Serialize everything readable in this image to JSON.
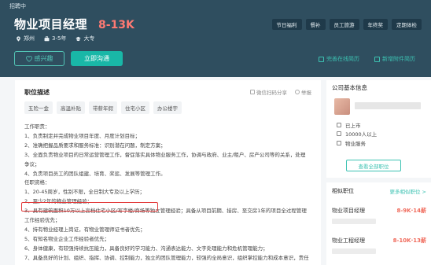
{
  "header": {
    "status": "招聘中",
    "job_title": "物业项目经理",
    "salary": "8-13K",
    "city": "郑州",
    "experience": "3-5年",
    "education": "大专",
    "tags": [
      "节日福利",
      "餐补",
      "员工旅游",
      "年终奖",
      "定期体检"
    ],
    "interest_label": "感兴趣",
    "chat_label": "立即沟通",
    "perfect_resume": "完善在线简历",
    "attach_resume": "新增附件简历"
  },
  "job": {
    "section_title": "职位描述",
    "wechat_share": "微信扫码分享",
    "report": "举报",
    "benefits": [
      "五险一金",
      "高温补贴",
      "带薪年假",
      "住宅小区",
      "办公楼宇"
    ],
    "desc_lines": [
      "工作职责：",
      "1、负责制定并完成物业项目年度、月度计划目标；",
      "2、准确把握品质要求和服务标准：识别潜在问题，制定方案；",
      "3、全面负责物业项目的日常运营管理工作，督促落实具体物业服务工作，协调与政府、业主/租户、房产公司等的关系，处理",
      "争议；",
      "4、负责项目员工的团队组建、培育、奖惩、发展等管理工作。",
      "任职资格：",
      "1、20-45周岁，性别不限，全日制大专及以上学历；",
      "2、至少2年的物业管理经验；",
      "3、具有建筑面积10万以上高档住宅小区/写字楼/商场等独立管理经验；具备从项目前期、接房、至交房1年的项目全过程管理",
      "工作经验优先；",
      "4、持有物业经理上岗证，有物业管理师证书者优先；",
      "5、有知名物业企业工作经验者优先；",
      "6、身体健康，有较强持续抗压能力，具备良好的学习能力、沟通表达能力、文字处理能力和危机管理能力；",
      "7、具备良好的计划、组织、指挥、协调、控制能力，独立的团队管理能力，较强的全局意识，组织掌控能力和成本意识，责任"
    ]
  },
  "company": {
    "section_title": "公司基本信息",
    "listed": "已上市",
    "size": "10000人以上",
    "industry": "物业服务",
    "view_all_label": "查看全部职位"
  },
  "similar": {
    "section_title": "相似职位",
    "more_label": "更多相似职位 >",
    "jobs": [
      {
        "title": "物业项目经理",
        "salary": "8-9K·14薪"
      },
      {
        "title": "物业工程经理",
        "salary": "8-10K·13薪"
      }
    ]
  },
  "colors": {
    "header_bg": "#2f4e5f",
    "accent": "#19b7a7",
    "salary": "#ff7a73",
    "highlight_box": "#e23a3a"
  }
}
